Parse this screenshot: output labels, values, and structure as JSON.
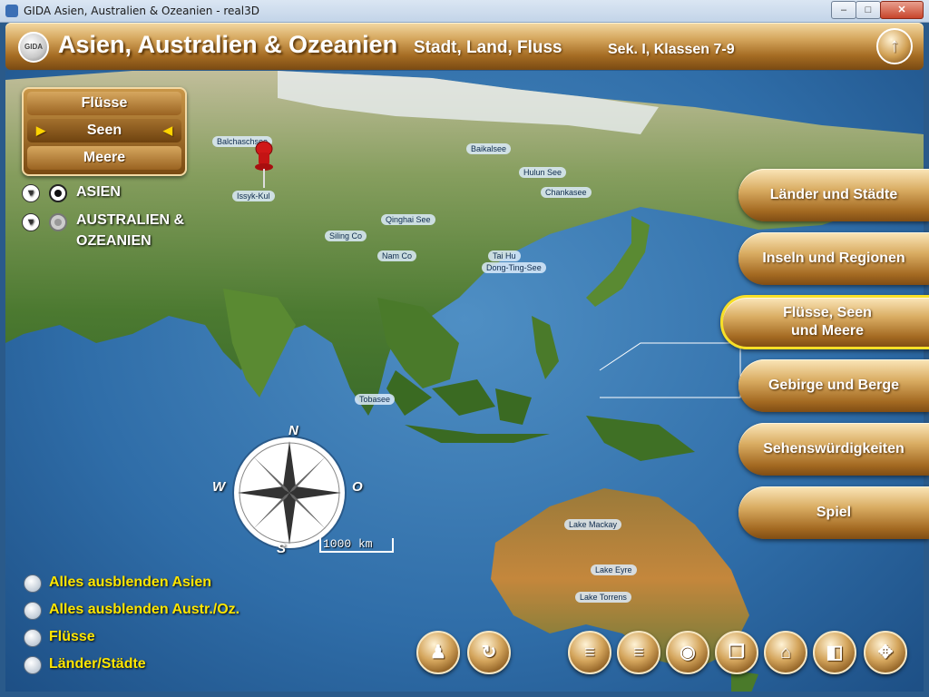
{
  "window": {
    "title": "GIDA Asien, Australien & Ozeanien - real3D",
    "controls": {
      "minimize": "–",
      "maximize": "□",
      "close": "✕"
    }
  },
  "header": {
    "logo": "GIDA",
    "title": "Asien, Australien & Ozeanien",
    "subtitle": "Stadt, Land, Fluss",
    "level": "Sek. I, Klassen 7-9",
    "up_icon": "↑"
  },
  "category_selector": {
    "items": [
      "Flüsse",
      "Seen",
      "Meere"
    ],
    "selected": "Seen",
    "arrow_left": "▶",
    "arrow_right": "◀"
  },
  "regions": [
    {
      "label": "ASIEN",
      "active": true
    },
    {
      "label": "AUSTRALIEN &",
      "label2": "OZEANIEN",
      "active": false
    }
  ],
  "menu": [
    {
      "label": "Länder und Städte"
    },
    {
      "label": "Inseln und Regionen"
    },
    {
      "label": "Flüsse, Seen",
      "label2": "und Meere",
      "active": true
    },
    {
      "label": "Gebirge und Berge"
    },
    {
      "label": "Sehenswürdigkeiten"
    },
    {
      "label": "Spiel"
    }
  ],
  "options": [
    "Alles ausblenden Asien",
    "Alles ausblenden Austr./Oz.",
    "Flüsse",
    "Länder/Städte"
  ],
  "compass": {
    "n": "N",
    "s": "S",
    "w": "W",
    "o": "O"
  },
  "scale": "1000 km",
  "map_labels": {
    "lake_mackay": "Lake Mackay",
    "lake_eyre": "Lake Eyre",
    "lake_torrens": "Lake Torrens",
    "tobasee": "Tobasee",
    "dongting": "Dong-Ting-See",
    "taihu": "Tai Hu",
    "namco": "Nam Co",
    "qinghai": "Qinghai See",
    "baikal": "Baikalsee",
    "hulun": "Hulun See",
    "khanka": "Chankasee",
    "issyk": "Issyk-Kul",
    "balkhash": "Balchaschsee",
    "siling": "Siling Co"
  },
  "toolbar": {
    "joystick": "♟",
    "reset": "↻",
    "list1": "≡",
    "list2": "≡",
    "camera": "◉",
    "copy": "❐",
    "home": "⌂",
    "window": "◧",
    "move": "✥"
  },
  "colors": {
    "gold_dark": "#7a4a12",
    "gold_light": "#f3d9a4",
    "option_text": "#ffe600",
    "active_border": "#f7df27",
    "selector_arrow": "#ffd400"
  }
}
